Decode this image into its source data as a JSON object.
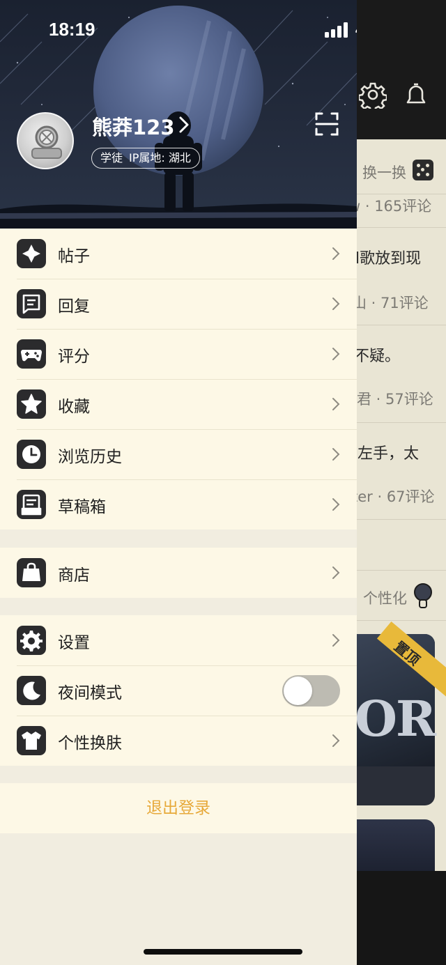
{
  "status_bar": {
    "time": "18:19",
    "network": "4G"
  },
  "profile": {
    "username": "熊莽123",
    "level_tag": "学徒",
    "ip_location": "IP属地: 湖北"
  },
  "menu_groups": {
    "main": [
      {
        "label": "帖子",
        "icon": "posts-icon"
      },
      {
        "label": "回复",
        "icon": "replies-icon"
      },
      {
        "label": "评分",
        "icon": "gamepad-icon"
      },
      {
        "label": "收藏",
        "icon": "star-icon"
      },
      {
        "label": "浏览历史",
        "icon": "clock-icon"
      },
      {
        "label": "草稿箱",
        "icon": "drafts-icon"
      }
    ],
    "shop": [
      {
        "label": "商店",
        "icon": "shopping-bag-icon"
      }
    ],
    "settings": [
      {
        "label": "设置",
        "icon": "gear-icon"
      },
      {
        "label": "夜间模式",
        "icon": "moon-icon",
        "toggle": false
      },
      {
        "label": "个性换肤",
        "icon": "tshirt-icon"
      }
    ]
  },
  "logout_label": "退出登录",
  "background_page": {
    "refresh_label": "换一换",
    "items": [
      {
        "title": "",
        "meta": "w · 165评论"
      },
      {
        "title": "l歌放到现",
        "meta": "山 · 71评论"
      },
      {
        "title": "不疑。",
        "meta": "君 · 57评论"
      },
      {
        "title": "左手，太",
        "meta": "ter · 67评论"
      }
    ],
    "personalize_label": "个性化",
    "pinned_badge": "置顶",
    "card_text": "OR"
  },
  "colors": {
    "drawer_background": "#fdf8e6",
    "accent": "#e7a93a",
    "icon_tile": "#2b2b2d"
  }
}
